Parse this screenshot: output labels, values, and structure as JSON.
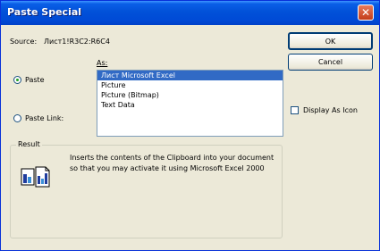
{
  "window": {
    "title": "Paste Special"
  },
  "source": {
    "label": "Source:",
    "value": "Лист1!R3C2:R6C4"
  },
  "buttons": {
    "ok": "OK",
    "cancel": "Cancel"
  },
  "as": {
    "label": "As:",
    "items": [
      "Лист Microsoft Excel",
      "Picture",
      "Picture (Bitmap)",
      "Text Data"
    ],
    "selected": 0
  },
  "options": {
    "paste": "Paste",
    "paste_link": "Paste Link:",
    "selected": "paste"
  },
  "display_as_icon": {
    "label": "Display As Icon",
    "checked": false
  },
  "result": {
    "label": "Result",
    "text": "Inserts the contents of the Clipboard into your document so that you may activate it using Microsoft Excel 2000"
  },
  "icons": {
    "close": "close-icon",
    "result": "paste-result-icon"
  },
  "colors": {
    "titlebar": "#0151d8",
    "selection": "#316ac5",
    "dialog": "#ece9d8"
  }
}
